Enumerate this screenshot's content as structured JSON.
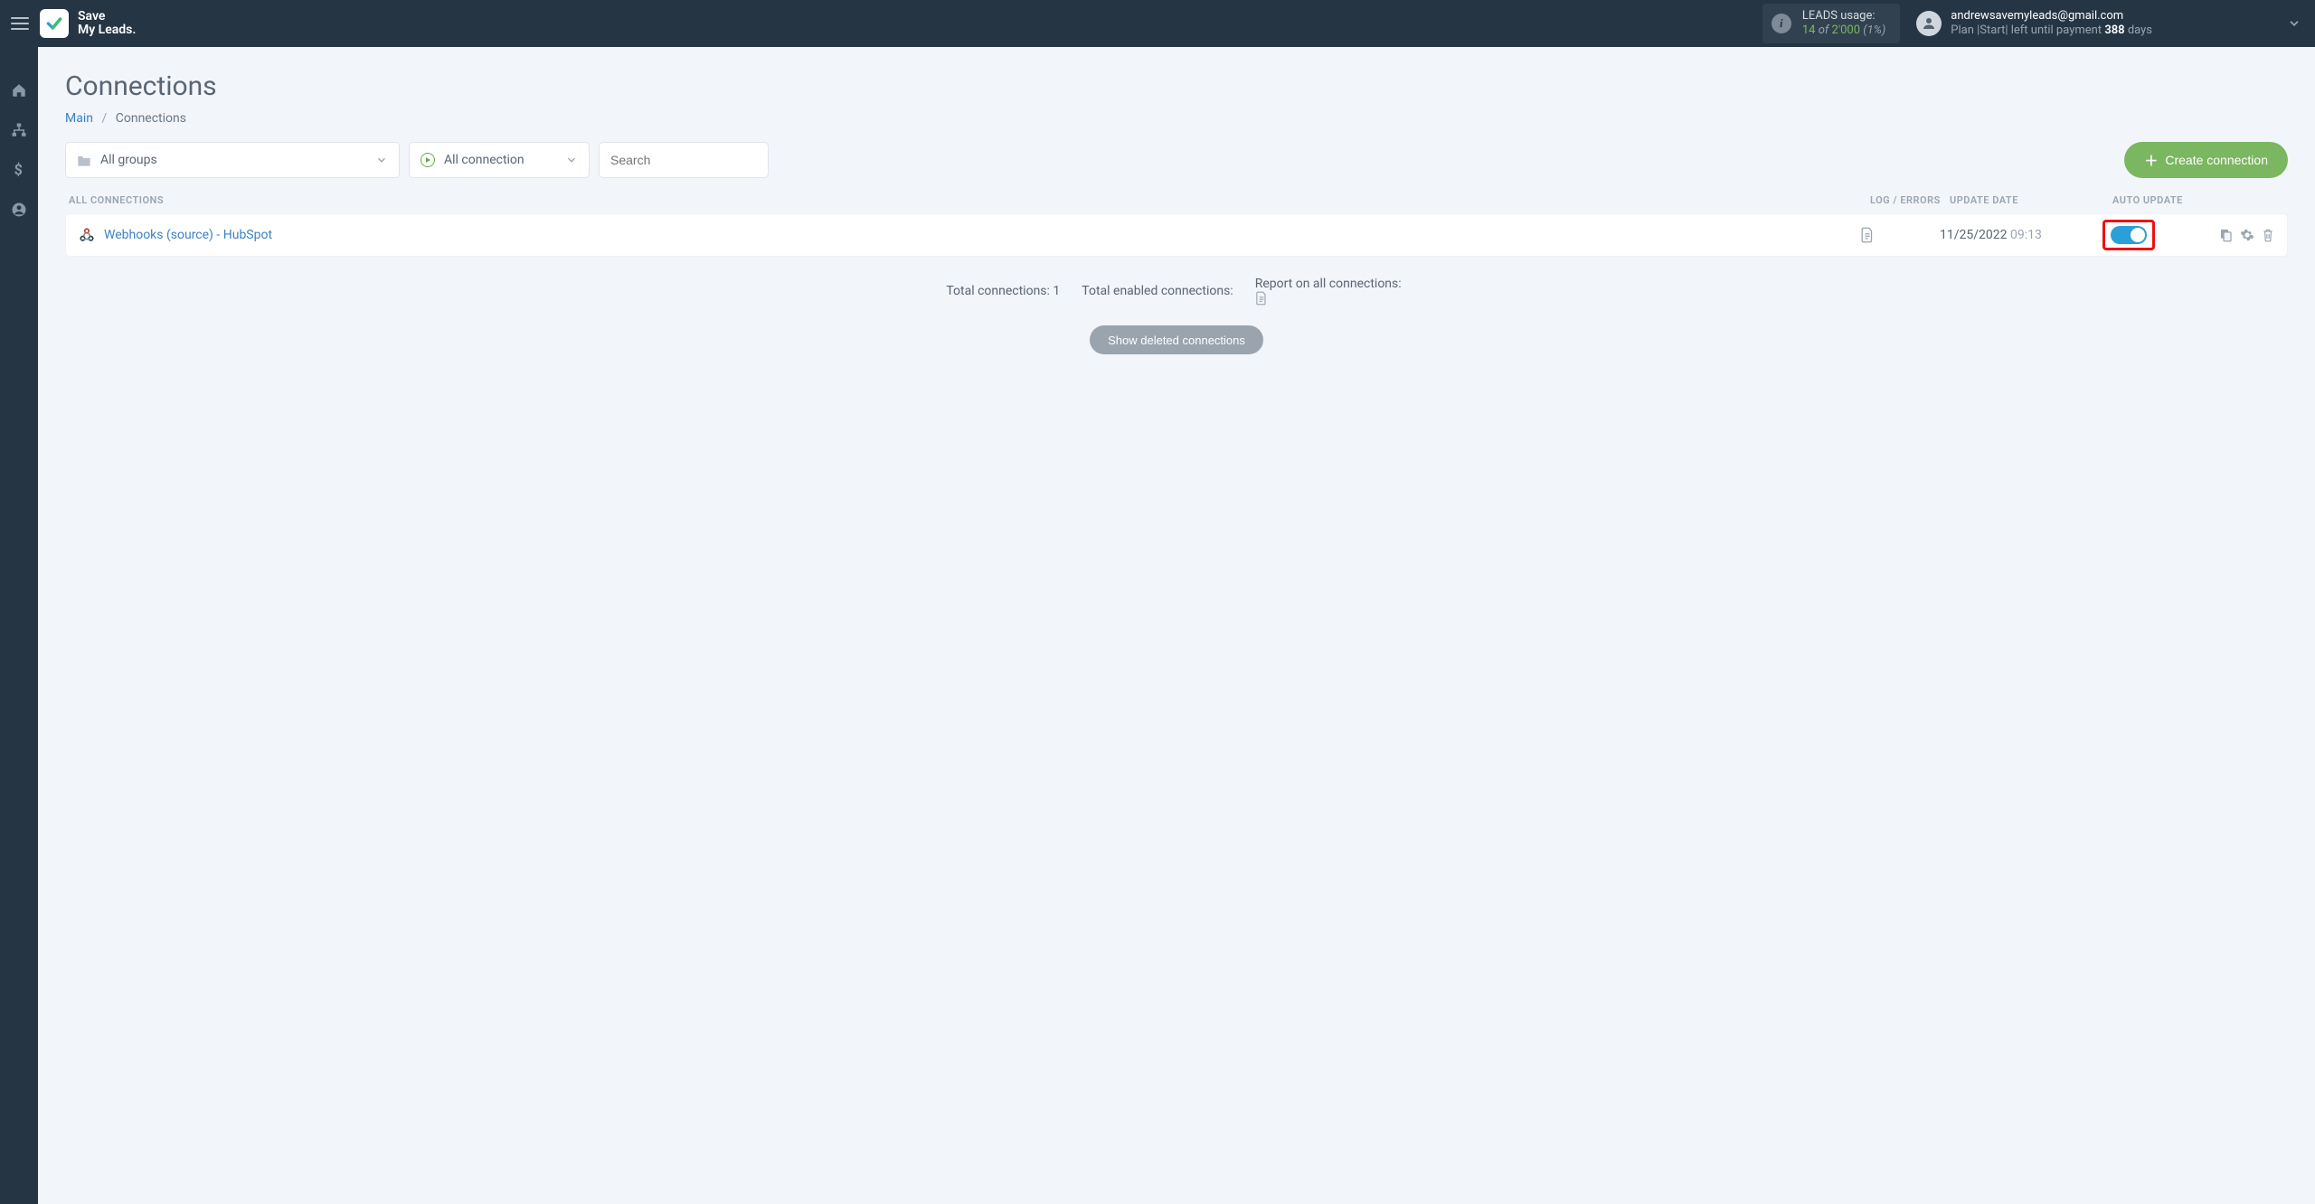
{
  "brand": {
    "line1": "Save",
    "line2": "My Leads."
  },
  "usage": {
    "label": "LEADS usage:",
    "count": "14",
    "of": "of",
    "total": "2'000",
    "pct": "(1%)"
  },
  "user": {
    "email": "andrewsavemyleads@gmail.com",
    "plan_prefix": "Plan |Start| left until payment ",
    "plan_days": "388",
    "plan_suffix": " days"
  },
  "page": {
    "title": "Connections",
    "breadcrumb_main": "Main",
    "breadcrumb_current": "Connections"
  },
  "filters": {
    "groups_label": "All groups",
    "status_label": "All connection",
    "search_placeholder": "Search"
  },
  "buttons": {
    "create": "Create connection",
    "show_deleted": "Show deleted connections"
  },
  "columns": {
    "name": "ALL CONNECTIONS",
    "log": "LOG / ERRORS",
    "date": "UPDATE DATE",
    "auto": "AUTO UPDATE"
  },
  "connections": [
    {
      "name": "Webhooks (source) - HubSpot",
      "date": "11/25/2022",
      "time": "09:13",
      "auto_update": true
    }
  ],
  "summary": {
    "total_label": "Total connections:",
    "total_value": "1",
    "enabled_label": "Total enabled connections:",
    "report_label": "Report on all connections:"
  }
}
